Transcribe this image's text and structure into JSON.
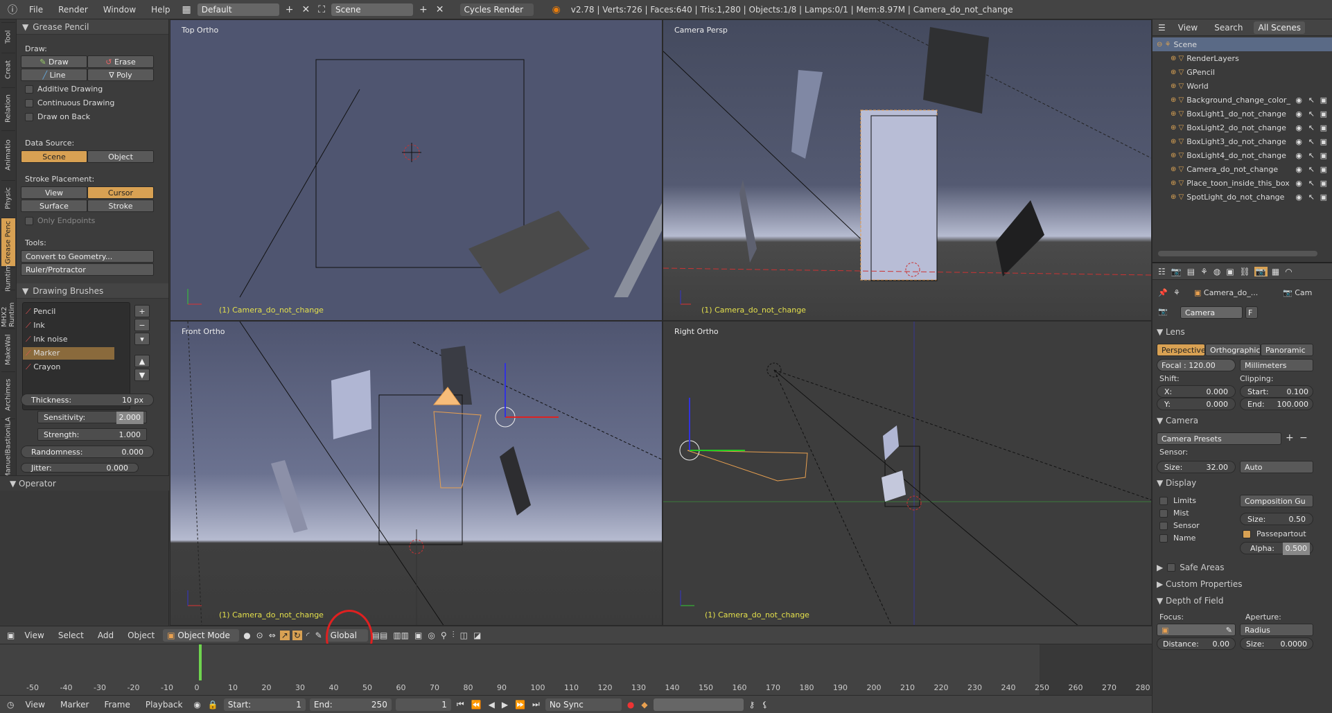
{
  "topbar": {
    "menus": [
      "File",
      "Render",
      "Window",
      "Help"
    ],
    "layout_value": "Default",
    "scene_value": "Scene",
    "render_engine": "Cycles Render",
    "stats": "v2.78 | Verts:726 | Faces:640 | Tris:1,280 | Objects:1/8 | Lamps:0/1 | Mem:8.97M | Camera_do_not_change"
  },
  "vtabs": [
    "Tool",
    "Creat",
    "Relation",
    "Animatio",
    "Physic",
    "Grease Penc",
    "Rumtim",
    "MHX2 Runtim",
    "MakeWal",
    "Archimes",
    "ManuelBastioniLA"
  ],
  "toolshelf": {
    "title": "Grease Pencil",
    "draw_label": "Draw:",
    "draw": "Draw",
    "erase": "Erase",
    "line": "Line",
    "poly": "Poly",
    "additive": "Additive Drawing",
    "continuous": "Continuous Drawing",
    "draw_back": "Draw on Back",
    "data_source_label": "Data Source:",
    "scene": "Scene",
    "object": "Object",
    "placement_label": "Stroke Placement:",
    "view": "View",
    "cursor": "Cursor",
    "surface": "Surface",
    "stroke": "Stroke",
    "only_endpoints": "Only Endpoints",
    "tools_label": "Tools:",
    "convert": "Convert to Geometry...",
    "ruler": "Ruler/Protractor",
    "brushes_title": "Drawing Brushes",
    "brushes": [
      "Pencil",
      "Ink",
      "Ink noise",
      "Marker",
      "Crayon"
    ],
    "thickness_label": "Thickness:",
    "thickness_value": "10 px",
    "sensitivity_label": "Sensitivity:",
    "sensitivity_value": "2.000",
    "strength_label": "Strength:",
    "strength_value": "1.000",
    "randomness_label": "Randomness:",
    "randomness_value": "0.000",
    "jitter_label": "Jitter:",
    "jitter_value": "0.000",
    "operator": "Operator"
  },
  "viewports": {
    "top": "Top Ortho",
    "camera": "Camera Persp",
    "front": "Front Ortho",
    "right": "Right Ortho",
    "object_label": "(1) Camera_do_not_change"
  },
  "vp_header": {
    "view": "View",
    "select": "Select",
    "add": "Add",
    "object": "Object",
    "mode": "Object Mode",
    "orientation": "Global"
  },
  "timeline": {
    "ticks": [
      "-50",
      "-40",
      "-30",
      "-20",
      "-10",
      "0",
      "10",
      "20",
      "30",
      "40",
      "50",
      "60",
      "70",
      "80",
      "90",
      "100",
      "110",
      "120",
      "130",
      "140",
      "150",
      "160",
      "170",
      "180",
      "190",
      "200",
      "210",
      "220",
      "230",
      "240",
      "250",
      "260",
      "270",
      "280"
    ],
    "menus": [
      "View",
      "Marker",
      "Frame",
      "Playback"
    ],
    "start_label": "Start:",
    "start_value": "1",
    "end_label": "End:",
    "end_value": "250",
    "current_frame": "1",
    "sync": "No Sync"
  },
  "outliner": {
    "view": "View",
    "search": "Search",
    "scope": "All Scenes",
    "items": [
      {
        "label": "Scene",
        "level": 0
      },
      {
        "label": "RenderLayers",
        "level": 1
      },
      {
        "label": "GPencil",
        "level": 1
      },
      {
        "label": "World",
        "level": 1
      },
      {
        "label": "Background_change_color_",
        "level": 1
      },
      {
        "label": "BoxLight1_do_not_change",
        "level": 1
      },
      {
        "label": "BoxLight2_do_not_change",
        "level": 1
      },
      {
        "label": "BoxLight3_do_not_change",
        "level": 1
      },
      {
        "label": "BoxLight4_do_not_change",
        "level": 1
      },
      {
        "label": "Camera_do_not_change",
        "level": 1
      },
      {
        "label": "Place_toon_inside_this_box",
        "level": 1
      },
      {
        "label": "SpotLight_do_not_change",
        "level": 1
      }
    ]
  },
  "props": {
    "breadcrumb_obj": "Camera_do_...",
    "breadcrumb_cam": "Cam",
    "camera_name": "Camera",
    "fake_user": "F",
    "lens_title": "Lens",
    "perspective": "Perspective",
    "orthographic": "Orthographic",
    "panoramic": "Panoramic",
    "focal": "Focal : 120.00",
    "units": "Millimeters",
    "shift_label": "Shift:",
    "clipping_label": "Clipping:",
    "x_label": "X:",
    "x_value": "0.000",
    "y_label": "Y:",
    "y_value": "0.000",
    "start_label": "Start:",
    "start_value": "0.100",
    "end_label": "End:",
    "end_value": "100.000",
    "camera_title": "Camera",
    "presets": "Camera Presets",
    "sensor_label": "Sensor:",
    "size_label": "Size:",
    "size_value": "32.00",
    "sensor_fit": "Auto",
    "display_title": "Display",
    "limits": "Limits",
    "mist": "Mist",
    "sensor": "Sensor",
    "name": "Name",
    "composition": "Composition Gu",
    "disp_size_label": "Size:",
    "disp_size_value": "0.50",
    "passepartout": "Passepartout",
    "alpha_label": "Alpha:",
    "alpha_value": "0.500",
    "safe_areas": "Safe Areas",
    "custom_props": "Custom Properties",
    "dof_title": "Depth of Field",
    "focus_label": "Focus:",
    "aperture_label": "Aperture:",
    "radius": "Radius",
    "distance_label": "Distance:",
    "distance_value": "0.00",
    "ap_size_label": "Size:",
    "ap_size_value": "0.0000"
  },
  "colors": {
    "accent": "#d8a153",
    "selection": "#5a6a86",
    "object_label": "#e4e04c",
    "annotation": "#e02020"
  }
}
